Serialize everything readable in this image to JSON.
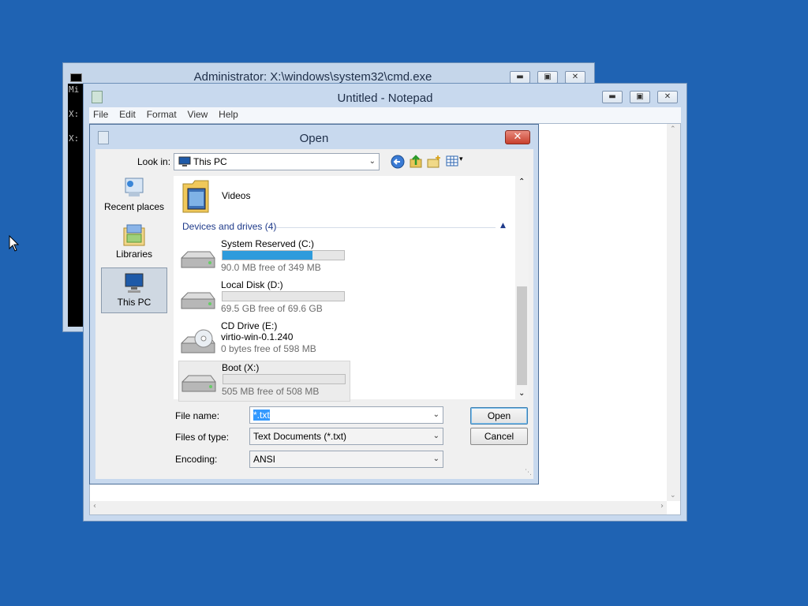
{
  "cmd": {
    "title": "Administrator: X:\\windows\\system32\\cmd.exe",
    "lines": [
      "Mi",
      "X:",
      "X:"
    ]
  },
  "notepad": {
    "title": "Untitled - Notepad",
    "menu": [
      "File",
      "Edit",
      "Format",
      "View",
      "Help"
    ]
  },
  "dialog": {
    "title": "Open",
    "look_in_label": "Look in:",
    "look_in_value": "This PC",
    "places": [
      {
        "label": "Recent places",
        "icon": "recent-places-icon"
      },
      {
        "label": "Libraries",
        "icon": "libraries-icon"
      },
      {
        "label": "This PC",
        "icon": "this-pc-icon",
        "selected": true
      }
    ],
    "folder": {
      "name": "Videos",
      "icon": "videos-folder-icon"
    },
    "group_header": "Devices and drives (4)",
    "drives": [
      {
        "name": "System Reserved (C:)",
        "free": "90.0 MB free of 349 MB",
        "used_fraction": 0.74,
        "icon": "hard-drive-icon"
      },
      {
        "name": "Local Disk (D:)",
        "free": "69.5 GB free of 69.6 GB",
        "used_fraction": 0.0,
        "icon": "hard-drive-icon"
      },
      {
        "name": "CD Drive (E:)",
        "label2": "virtio-win-0.1.240",
        "free": "0 bytes free of 598 MB",
        "icon": "cd-drive-icon"
      },
      {
        "name": "Boot (X:)",
        "free": "505 MB free of 508 MB",
        "used_fraction": 0.0,
        "icon": "hard-drive-icon",
        "selected": true
      }
    ],
    "file_name_label": "File name:",
    "file_name_value": "*.txt",
    "file_type_label": "Files of type:",
    "file_type_value": "Text Documents (*.txt)",
    "encoding_label": "Encoding:",
    "encoding_value": "ANSI",
    "open_button": "Open",
    "cancel_button": "Cancel"
  }
}
